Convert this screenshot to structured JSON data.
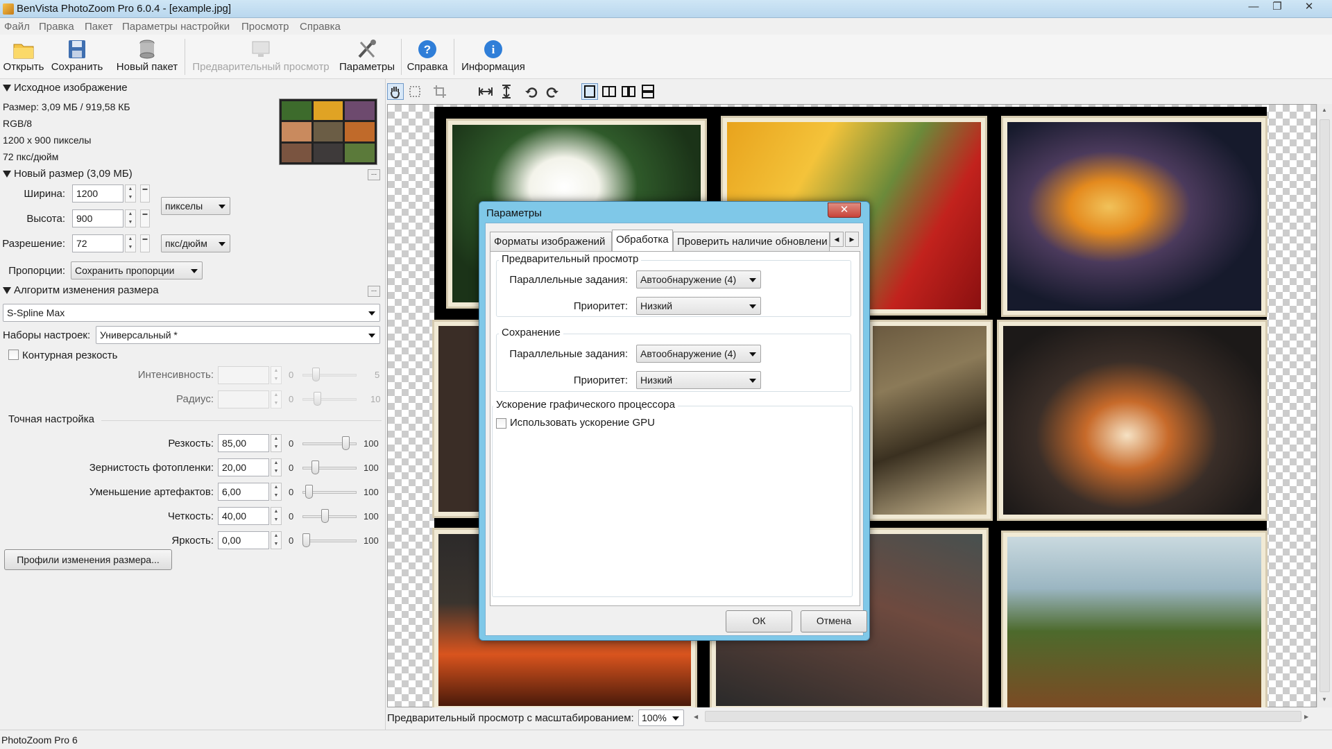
{
  "window": {
    "title": "BenVista PhotoZoom Pro 6.0.4 - [example.jpg]",
    "controls": {
      "minimize": "—",
      "maximize": "❐",
      "close": "✕"
    }
  },
  "menu": [
    "Файл",
    "Правка",
    "Пакет",
    "Параметры настройки",
    "Просмотр",
    "Справка"
  ],
  "toolbar": {
    "open": "Открыть",
    "save": "Сохранить",
    "new_batch": "Новый пакет",
    "preview": "Предварительный просмотр",
    "settings": "Параметры",
    "help": "Справка",
    "info": "Информация"
  },
  "source": {
    "header": "Исходное изображение",
    "size": "Размер: 3,09 МБ / 919,58 КБ",
    "mode": "RGB/8",
    "dimensions": "1200 x 900 пикселы",
    "dpi": "72 пкс/дюйм"
  },
  "new_size": {
    "header": "Новый размер (3,09 МБ)",
    "width_label": "Ширина:",
    "width": "1200",
    "height_label": "Высота:",
    "height": "900",
    "resolution_label": "Разрешение:",
    "resolution": "72",
    "units": "пикселы",
    "res_units": "пкс/дюйм",
    "proportions_label": "Пропорции:",
    "proportions": "Сохранить пропорции"
  },
  "algorithm": {
    "header": "Алгоритм изменения размера",
    "method": "S-Spline Max",
    "presets_label": "Наборы настроек:",
    "preset": "Универсальный *"
  },
  "unsharp": {
    "label": "Контурная резкость",
    "intensity_label": "Интенсивность:",
    "intensity_min": "0",
    "intensity_max": "5",
    "radius_label": "Радиус:",
    "radius_min": "0",
    "radius_max": "10"
  },
  "fine_tune": {
    "header": "Точная настройка",
    "rows": [
      {
        "label": "Резкость:",
        "value": "85,00",
        "min": "0",
        "max": "100",
        "level": 0.85
      },
      {
        "label": "Зернистость фотопленки:",
        "value": "20,00",
        "min": "0",
        "max": "100",
        "level": 0.2
      },
      {
        "label": "Уменьшение артефактов:",
        "value": "6,00",
        "min": "0",
        "max": "100",
        "level": 0.06
      },
      {
        "label": "Четкость:",
        "value": "40,00",
        "min": "0",
        "max": "100",
        "level": 0.4
      },
      {
        "label": "Яркость:",
        "value": "0,00",
        "min": "0",
        "max": "100",
        "level": 0.0
      }
    ],
    "profiles_button": "Профили изменения размера..."
  },
  "preview": {
    "zoom_label": "Предварительный просмотр с масштабированием:",
    "zoom": "100%"
  },
  "status": {
    "text": "PhotoZoom Pro 6"
  },
  "dialog": {
    "title": "Параметры",
    "close": "✕",
    "tabs": [
      "Форматы изображений",
      "Обработка",
      "Проверить наличие обновлени"
    ],
    "selected_tab": "Обработка",
    "groups": {
      "preview": {
        "title": "Предварительный просмотр",
        "jobs_label": "Параллельные задания:",
        "jobs": "Автообнаружение (4)",
        "priority_label": "Приоритет:",
        "priority": "Низкий"
      },
      "saving": {
        "title": "Сохранение",
        "jobs_label": "Параллельные задания:",
        "jobs": "Автообнаружение (4)",
        "priority_label": "Приоритет:",
        "priority": "Низкий"
      },
      "gpu": {
        "title": "Ускорение графического процессора",
        "checkbox": "Использовать ускорение GPU",
        "checked": false
      }
    },
    "ok": "ОК",
    "cancel": "Отмена"
  },
  "colors": {
    "dialog_frame": "#7fc8e8",
    "close_red": "#c8433a",
    "frame_cream": "#f1ead5"
  }
}
